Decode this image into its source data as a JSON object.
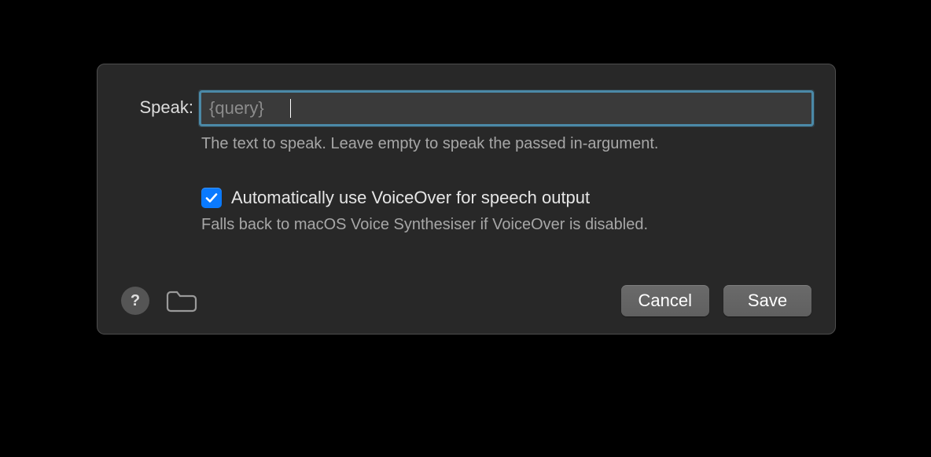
{
  "form": {
    "speak_label": "Speak:",
    "speak_placeholder": "{query}",
    "speak_value": "",
    "speak_help": "The text to speak. Leave empty to speak the passed in-argument.",
    "voiceover_checked": true,
    "voiceover_label": "Automatically use VoiceOver for speech output",
    "voiceover_help": "Falls back to macOS Voice Synthesiser if VoiceOver is disabled."
  },
  "footer": {
    "help_glyph": "?",
    "cancel_label": "Cancel",
    "save_label": "Save"
  },
  "colors": {
    "accent": "#0a7aff",
    "focus_ring": "#4b89a7",
    "panel_bg": "#282828",
    "panel_border": "#4e4e4e"
  }
}
